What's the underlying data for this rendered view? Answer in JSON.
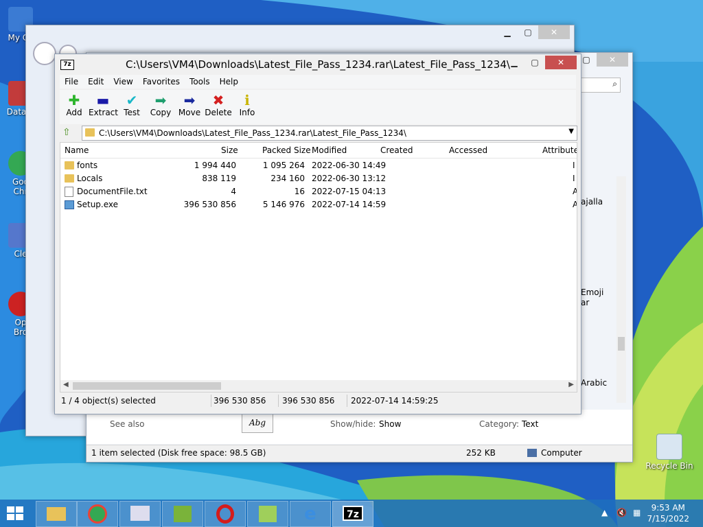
{
  "desktop": {
    "icons": [
      {
        "label": "My Co",
        "color": "#3b7bd3"
      },
      {
        "label": "DataW",
        "color": "#c23b3b"
      },
      {
        "label": "Goo\nChr",
        "color": "#34a853"
      },
      {
        "label": "Cle",
        "color": "#5577cc"
      },
      {
        "label": "Op\nBro",
        "color": "#cc2222"
      }
    ],
    "recycle_bin": "Recycle Bin"
  },
  "fonts_window": {
    "status_selected": "1 item selected (Disk free space: 98.5 GB)",
    "status_size": "252 KB",
    "status_location": "Computer",
    "see_also": "See also",
    "show_hide_label": "Show/hide:",
    "show_hide_value": "Show",
    "category_label": "Category:",
    "category_value": "Text",
    "preview": "Abg",
    "side_items": [
      "ajalla",
      "Emoji",
      "ar",
      "Arabic"
    ]
  },
  "zip_window": {
    "logo": "7z",
    "title": "C:\\Users\\VM4\\Downloads\\Latest_File_Pass_1234.rar\\Latest_File_Pass_1234\\",
    "menu": [
      "File",
      "Edit",
      "View",
      "Favorites",
      "Tools",
      "Help"
    ],
    "toolbar": [
      {
        "label": "Add",
        "icon": "plus-icon",
        "color": "#2db52d",
        "glyph": "✚"
      },
      {
        "label": "Extract",
        "icon": "minus-icon",
        "color": "#1a1aa8",
        "glyph": "▬"
      },
      {
        "label": "Test",
        "icon": "check-icon",
        "color": "#1ab8c8",
        "glyph": "✔"
      },
      {
        "label": "Copy",
        "icon": "copy-arrow-icon",
        "color": "#1e9e6e",
        "glyph": "➡"
      },
      {
        "label": "Move",
        "icon": "move-arrow-icon",
        "color": "#1a2a9e",
        "glyph": "➡"
      },
      {
        "label": "Delete",
        "icon": "delete-icon",
        "color": "#d42020",
        "glyph": "✖"
      },
      {
        "label": "Info",
        "icon": "info-icon",
        "color": "#c8b400",
        "glyph": "ℹ"
      }
    ],
    "address": "C:\\Users\\VM4\\Downloads\\Latest_File_Pass_1234.rar\\Latest_File_Pass_1234\\",
    "columns": [
      "Name",
      "Size",
      "Packed Size",
      "Modified",
      "Created",
      "Accessed",
      "Attribute"
    ],
    "rows": [
      {
        "name": "fonts",
        "type": "folder",
        "size": "1 994 440",
        "packed": "1 095 264",
        "modified": "2022-06-30 14:49",
        "attr": "I"
      },
      {
        "name": "Locals",
        "type": "folder",
        "size": "838 119",
        "packed": "234 160",
        "modified": "2022-06-30 13:12",
        "attr": "I"
      },
      {
        "name": "DocumentFile.txt",
        "type": "file",
        "size": "4",
        "packed": "16",
        "modified": "2022-07-15 04:13",
        "attr": "A"
      },
      {
        "name": "Setup.exe",
        "type": "exe",
        "size": "396 530 856",
        "packed": "5 146 976",
        "modified": "2022-07-14 14:59",
        "attr": "A"
      }
    ],
    "status": {
      "selected": "1 / 4 object(s) selected",
      "size": "396 530 856",
      "packed": "396 530 856",
      "modified": "2022-07-14 14:59:25"
    }
  },
  "taskbar": {
    "clock_time": "9:53 AM",
    "clock_date": "7/15/2022",
    "zip_icon_label": "7z"
  }
}
